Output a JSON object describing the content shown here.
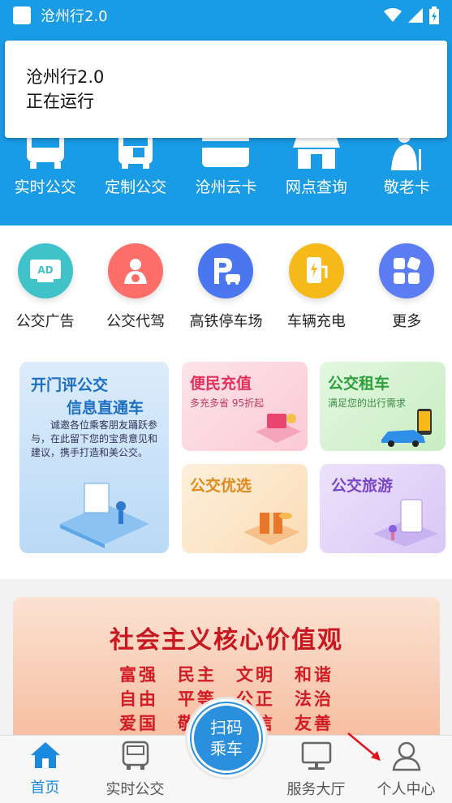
{
  "status_bar": {
    "app_title": "沧州行2.0"
  },
  "notification": {
    "title": "沧州行2.0",
    "subtitle": "正在运行"
  },
  "quick_menu": [
    {
      "label": "实时公交",
      "icon": "bus-icon"
    },
    {
      "label": "定制公交",
      "icon": "custom-bus-icon"
    },
    {
      "label": "沧州云卡",
      "icon": "card-icon"
    },
    {
      "label": "网点查询",
      "icon": "store-icon"
    },
    {
      "label": "敬老卡",
      "icon": "elder-icon"
    }
  ],
  "services": [
    {
      "label": "公交广告",
      "icon": "ad-icon",
      "color": "#3fc3c8",
      "badge": "AD"
    },
    {
      "label": "公交代驾",
      "icon": "driver-icon",
      "color": "#ff6f6a"
    },
    {
      "label": "高铁停车场",
      "icon": "parking-icon",
      "color": "#4a76f0"
    },
    {
      "label": "车辆充电",
      "icon": "charging-icon",
      "color": "#f6b91a"
    },
    {
      "label": "更多",
      "icon": "more-icon",
      "color": "#5b7cf2"
    }
  ],
  "cards": {
    "feedback": {
      "title1": "开门评公交",
      "title2": "信息直通车",
      "desc": "诚邀各位乘客朋友踊跃参与，在此留下您的宝贵意见和建议，携手打造和美公交。"
    },
    "recharge": {
      "title": "便民充值",
      "sub": "多充多省 95折起"
    },
    "rent": {
      "title": "公交租车",
      "sub": "满足您的出行需求"
    },
    "pick": {
      "title": "公交优选"
    },
    "travel": {
      "title": "公交旅游"
    }
  },
  "banner": {
    "title": "社会主义核心价值观",
    "lines": [
      "富强　民主　文明　和谐",
      "自由　平等　公正　法治",
      "爱国　敬业　诚信　友善"
    ]
  },
  "bottom_nav": {
    "home": "首页",
    "realtime": "实时公交",
    "scan_line1": "扫码",
    "scan_line2": "乘车",
    "service_hall": "服务大厅",
    "profile": "个人中心"
  }
}
